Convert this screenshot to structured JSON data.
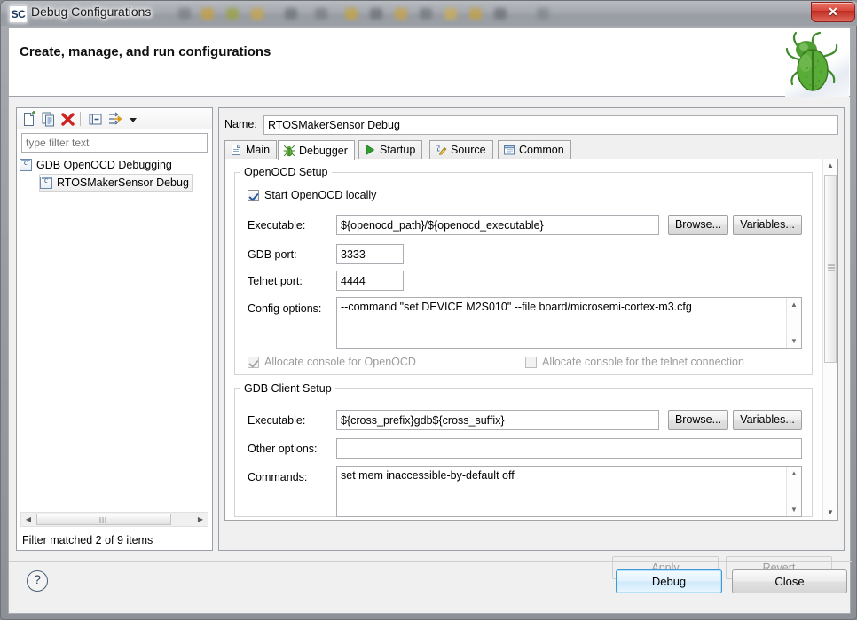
{
  "window": {
    "title": "Debug Configurations",
    "logo_text": "SC",
    "close_label": "✕",
    "close_icon": "close-icon"
  },
  "header": {
    "title": "Create, manage, and run configurations",
    "banner_icon": "green-bug-icon"
  },
  "left_panel": {
    "toolbar": [
      {
        "name": "new-launch-configuration-icon",
        "tooltip": "New launch configuration"
      },
      {
        "name": "duplicate-configuration-icon",
        "tooltip": "Duplicate currently selected launch configuration"
      },
      {
        "name": "delete-configuration-icon",
        "tooltip": "Delete selected launch configuration(s)"
      },
      {
        "name": "collapse-all-icon",
        "tooltip": "Collapse All"
      },
      {
        "name": "filter-icon",
        "tooltip": "Filter launch configurations"
      },
      {
        "name": "chevron-down-icon",
        "tooltip": "View Menu"
      }
    ],
    "filter": {
      "value": "",
      "placeholder": "type filter text"
    },
    "tree": [
      {
        "label": "GDB OpenOCD Debugging",
        "icon": "configuration-type-icon",
        "level": 0,
        "selected": false
      },
      {
        "label": "RTOSMakerSensor Debug",
        "icon": "configuration-icon",
        "level": 1,
        "selected": true
      }
    ],
    "status": "Filter matched 2 of 9 items",
    "hscroll": {
      "left_arrow": "◀",
      "right_arrow": "▶"
    }
  },
  "right_panel": {
    "name_label": "Name:",
    "name_value": "RTOSMakerSensor Debug",
    "tabs": [
      {
        "label": "Main",
        "icon": "document-icon",
        "active": false
      },
      {
        "label": "Debugger",
        "icon": "bug-icon",
        "active": true
      },
      {
        "label": "Startup",
        "icon": "play-icon",
        "active": false
      },
      {
        "label": "Source",
        "icon": "edit-source-icon",
        "active": false
      },
      {
        "label": "Common",
        "icon": "window-icon",
        "active": false
      }
    ],
    "openocd_setup": {
      "legend": "OpenOCD Setup",
      "start_locally": {
        "label": "Start OpenOCD locally",
        "checked": true,
        "enabled": true
      },
      "executable_label": "Executable:",
      "executable_value": "${openocd_path}/${openocd_executable}",
      "browse_label": "Browse...",
      "variables_label": "Variables...",
      "gdb_port_label": "GDB port:",
      "gdb_port_value": "3333",
      "telnet_port_label": "Telnet port:",
      "telnet_port_value": "4444",
      "config_options_label": "Config options:",
      "config_options_value": "--command \"set DEVICE M2S010\" --file board/microsemi-cortex-m3.cfg",
      "allocate_console_openocd": {
        "label": "Allocate console for OpenOCD",
        "checked": true,
        "enabled": false
      },
      "allocate_console_telnet": {
        "label": "Allocate console for the telnet connection",
        "checked": false,
        "enabled": false
      }
    },
    "gdb_client_setup": {
      "legend": "GDB Client Setup",
      "executable_label": "Executable:",
      "executable_value": "${cross_prefix}gdb${cross_suffix}",
      "browse_label": "Browse...",
      "variables_label": "Variables...",
      "other_options_label": "Other options:",
      "other_options_value": "",
      "commands_label": "Commands:",
      "commands_value": "set mem inaccessible-by-default off"
    },
    "scrollbar": {
      "up_arrow": "▲",
      "down_arrow": "▼"
    },
    "apply_label": "Apply",
    "apply_enabled": false,
    "revert_label": "Revert",
    "revert_enabled": false
  },
  "footer": {
    "help_label": "?",
    "debug_label": "Debug",
    "close_label": "Close"
  },
  "colors": {
    "accent_blue": "#3c9ad9",
    "bug_green": "#56a832",
    "delete_red": "#cc2222",
    "disabled_text": "#9c9c9c"
  }
}
